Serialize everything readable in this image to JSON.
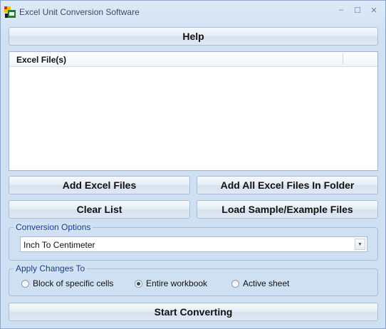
{
  "window": {
    "title": "Excel Unit Conversion Software",
    "minimize_glyph": "–",
    "maximize_glyph": "☐",
    "close_glyph": "✕"
  },
  "buttons": {
    "help": "Help",
    "add_files": "Add Excel Files",
    "add_folder": "Add All Excel Files In Folder",
    "clear_list": "Clear List",
    "load_sample": "Load Sample/Example Files",
    "start": "Start Converting"
  },
  "file_list": {
    "column_header": "Excel File(s)",
    "rows": []
  },
  "conversion_options": {
    "label": "Conversion Options",
    "selected": "Inch To Centimeter",
    "dropdown_icon": "chevron-down-icon"
  },
  "apply_changes": {
    "label": "Apply Changes To",
    "options": [
      {
        "label": "Block of specific cells",
        "checked": false
      },
      {
        "label": "Entire workbook",
        "checked": true
      },
      {
        "label": "Active sheet",
        "checked": false
      }
    ]
  },
  "colors": {
    "accent_label": "#1b3d8a",
    "window_bg": "#cfe0f3"
  }
}
